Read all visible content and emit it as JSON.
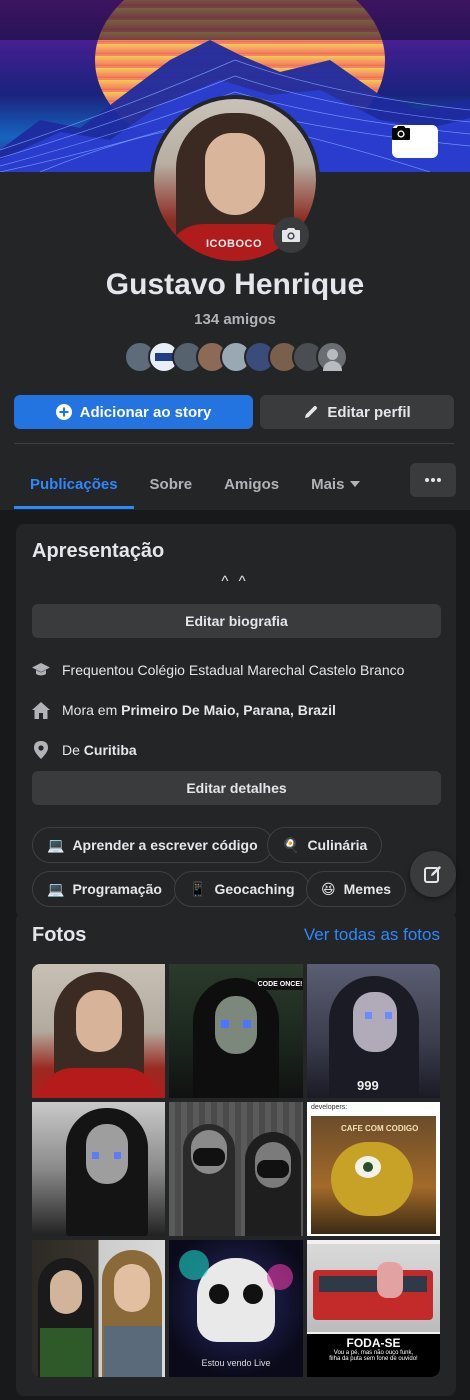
{
  "profile": {
    "name": "Gustavo Henrique",
    "friends_count": "134 amigos",
    "avatar_shirt_text": "ICOBOCO"
  },
  "actions": {
    "add_story": "Adicionar ao story",
    "edit_profile": "Editar perfil"
  },
  "tabs": [
    {
      "label": "Publicações",
      "active": true
    },
    {
      "label": "Sobre"
    },
    {
      "label": "Amigos"
    },
    {
      "label": "Mais"
    }
  ],
  "intro": {
    "title": "Apresentação",
    "caret": "^ ^",
    "edit_bio": "Editar biografia",
    "edit_details": "Editar detalhes",
    "details": [
      {
        "icon": "graduation-cap-icon",
        "prefix": "Frequentou Colégio Estadual Marechal Castelo Branco",
        "bold": ""
      },
      {
        "icon": "home-icon",
        "prefix": "Mora em ",
        "bold": "Primeiro De Maio, Parana, Brazil"
      },
      {
        "icon": "location-pin-icon",
        "prefix": "De ",
        "bold": "Curitiba"
      }
    ],
    "hobbies": [
      {
        "emoji": "💻",
        "label": "Aprender a escrever código"
      },
      {
        "emoji": "🍳",
        "label": "Culinária"
      },
      {
        "emoji": "💻",
        "label": "Programação"
      },
      {
        "emoji": "📱",
        "label": "Geocaching"
      },
      {
        "emoji": "😆",
        "label": "Memes"
      }
    ]
  },
  "photos": {
    "title": "Fotos",
    "see_all": "Ver todas as fotos",
    "captions": {
      "code_once": "CODE ONCE!",
      "nines": "999",
      "developers": "developers:",
      "cafe": "CAFE COM CODIGO",
      "bus_title": "FODA-SE",
      "bus_sub": "Vou a pé, mas não ouço funk,",
      "bus_sub2": "filha da puta sem fone de ouvido!",
      "skull_sub": "Estou vendo Live"
    }
  },
  "colors": {
    "page_bg": "#18191a",
    "card_bg": "#242526",
    "button_bg": "#3a3b3c",
    "primary": "#2374e1",
    "link": "#2d88ff"
  }
}
